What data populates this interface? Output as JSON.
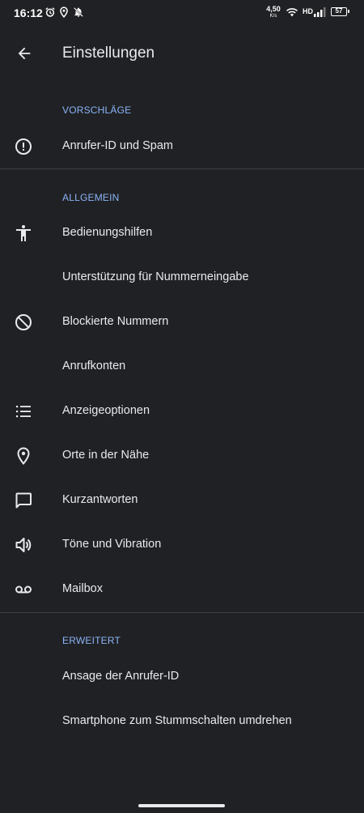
{
  "status_bar": {
    "time": "16:12",
    "network_speed_value": "4,50",
    "network_speed_unit": "K/s",
    "network_type": "HD",
    "battery_level": "57"
  },
  "header": {
    "title": "Einstellungen"
  },
  "sections": {
    "suggestions": {
      "title": "VORSCHLÄGE",
      "items": [
        {
          "label": "Anrufer-ID und Spam",
          "icon": "alert-circle-icon"
        }
      ]
    },
    "general": {
      "title": "ALLGEMEIN",
      "items": [
        {
          "label": "Bedienungshilfen",
          "icon": "accessibility-icon"
        },
        {
          "label": "Unterstützung für Nummerneingabe",
          "icon": ""
        },
        {
          "label": "Blockierte Nummern",
          "icon": "block-icon"
        },
        {
          "label": "Anrufkonten",
          "icon": ""
        },
        {
          "label": "Anzeigeoptionen",
          "icon": "list-icon"
        },
        {
          "label": "Orte in der Nähe",
          "icon": "location-pin-icon"
        },
        {
          "label": "Kurzantworten",
          "icon": "message-icon"
        },
        {
          "label": "Töne und Vibration",
          "icon": "speaker-icon"
        },
        {
          "label": "Mailbox",
          "icon": "voicemail-icon"
        }
      ]
    },
    "advanced": {
      "title": "ERWEITERT",
      "items": [
        {
          "label": "Ansage der Anrufer-ID",
          "icon": ""
        },
        {
          "label": "Smartphone zum Stummschalten umdrehen",
          "icon": ""
        }
      ]
    }
  },
  "colors": {
    "background": "#202124",
    "text": "#e8eaed",
    "section_header": "#8ab4f8",
    "divider": "#3c4043"
  }
}
